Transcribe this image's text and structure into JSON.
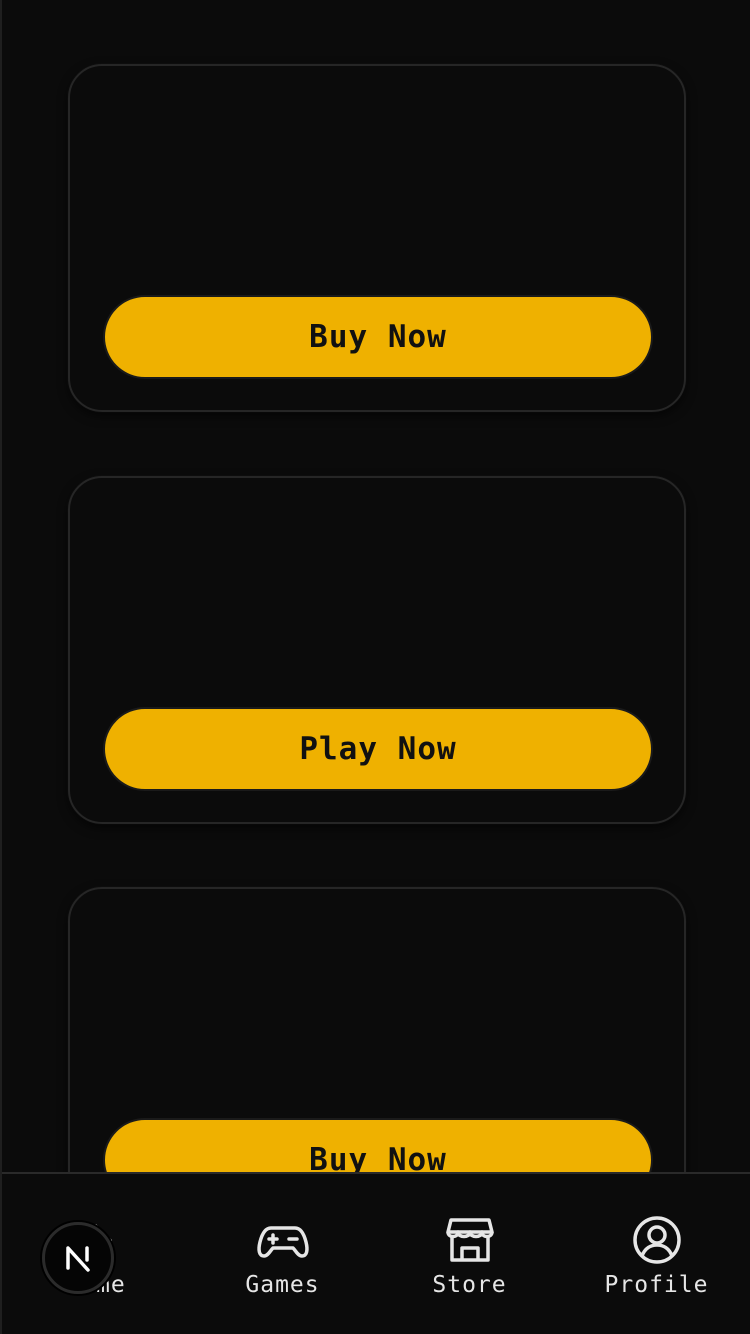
{
  "cards": [
    {
      "button_label": "Buy Now"
    },
    {
      "button_label": "Play Now"
    },
    {
      "button_label": "Buy Now"
    }
  ],
  "tabbar": {
    "items": [
      {
        "label": "Home",
        "icon": "home-icon"
      },
      {
        "label": "Games",
        "icon": "gamepad-icon"
      },
      {
        "label": "Store",
        "icon": "store-icon"
      },
      {
        "label": "Profile",
        "icon": "profile-icon"
      }
    ]
  },
  "badge": {
    "letter": "N"
  },
  "colors": {
    "background": "#0b0b0b",
    "accent": "#efb100",
    "card_border": "#262626",
    "text_light": "#e6e6e6",
    "button_text": "#111111"
  }
}
